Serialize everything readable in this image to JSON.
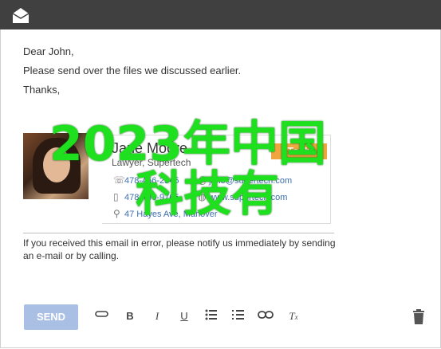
{
  "email": {
    "greeting": "Dear John,",
    "line1": "Please send over the files we discussed earlier.",
    "closing": "Thanks,"
  },
  "signature": {
    "name": "Jane Moore",
    "title": "Lawyer, Supertech",
    "badge": "Tech",
    "phone": "478-456-2345",
    "email": "jane@supertech.com",
    "mobile": "478-456-9765",
    "website": "www.supertech.com",
    "address": "47 Hayes Ave, Manover"
  },
  "disclaimer": "If you received this email in error, please notify us immediately by sending an e-mail or by calling.",
  "overlay": {
    "line1": "2023年中国",
    "line2": "科技有"
  },
  "toolbar": {
    "send_label": "SEND"
  },
  "icons": [
    "mail-icon",
    "attach-icon",
    "bold-icon",
    "italic-icon",
    "underline-icon",
    "bullet-list-icon",
    "numbered-list-icon",
    "link-icon",
    "clear-format-icon",
    "trash-icon"
  ]
}
